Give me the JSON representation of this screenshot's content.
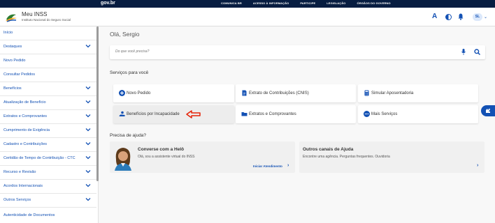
{
  "govbar": {
    "logo": "gov.br",
    "links": [
      "COMUNICA BR",
      "ACESSO À INFORMAÇÃO",
      "PARTICIPE",
      "LEGISLAÇÃO",
      "ÓRGÃOS DO GOVERNO"
    ]
  },
  "header": {
    "title": "Meu INSS",
    "subtitle": "Instituto Nacional do Seguro Social",
    "font_toggle": "A",
    "avatar_initials": "SL"
  },
  "sidebar": {
    "items": [
      {
        "label": "Início",
        "expandable": false
      },
      {
        "label": "Destaques",
        "expandable": true
      },
      {
        "label": "Novo Pedido",
        "expandable": false
      },
      {
        "label": "Consultar Pedidos",
        "expandable": false
      },
      {
        "label": "Benefícios",
        "expandable": true
      },
      {
        "label": "Atualização de Benefício",
        "expandable": true
      },
      {
        "label": "Extratos e Comprovantes",
        "expandable": true
      },
      {
        "label": "Cumprimento de Exigência",
        "expandable": true
      },
      {
        "label": "Cadastro e Contribuições",
        "expandable": true
      },
      {
        "label": "Certidão de Tempo de Contribuição - CTC",
        "expandable": true
      },
      {
        "label": "Recurso e Revisão",
        "expandable": true
      },
      {
        "label": "Acordos Internacionais",
        "expandable": true
      },
      {
        "label": "Outros Serviços",
        "expandable": true
      },
      {
        "label": "Autenticidade de Documentos",
        "expandable": false
      }
    ]
  },
  "main": {
    "greeting": "Olá, Sergio",
    "search_placeholder": "Do que você precisa?",
    "services_title": "Serviços para você",
    "services": [
      {
        "label": "Novo Pedido",
        "icon": "plus-circle-icon"
      },
      {
        "label": "Extrato de Contribuições (CNIS)",
        "icon": "document-icon"
      },
      {
        "label": "Simular Aposentadoria",
        "icon": "calculator-icon"
      },
      {
        "label": "Benefícios por Incapacidade",
        "icon": "person-bed-icon"
      },
      {
        "label": "Extratos e Comprovantes",
        "icon": "folder-icon"
      },
      {
        "label": "Mais Serviços",
        "icon": "more-dots-icon"
      }
    ],
    "help_title": "Precisa de ajuda?",
    "help_cards": [
      {
        "title": "Converse com a Helô",
        "subtitle": "Olá, sou a assistente virtual do INSS",
        "link": "Iniciar Atendimento"
      },
      {
        "title": "Outros canais de Ajuda",
        "subtitle": "Encontre uma agência. Perguntas frequentes. Ouvidoria",
        "link": ""
      }
    ]
  },
  "colors": {
    "gov_blue": "#071d41",
    "primary": "#1351b4",
    "annotation_arrow": "#e52207"
  }
}
